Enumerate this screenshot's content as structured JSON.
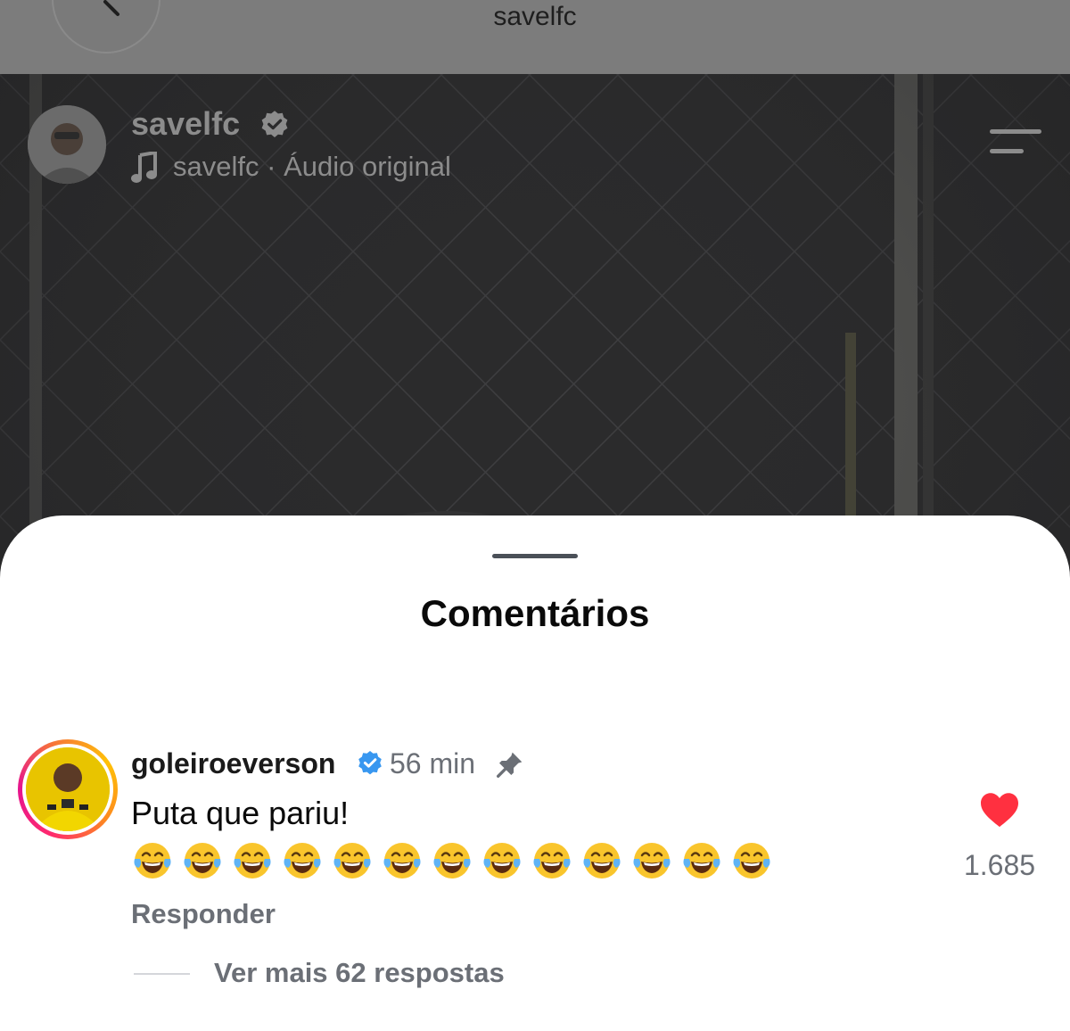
{
  "header": {
    "title": "savelfc",
    "back_icon": "chevron-left-icon"
  },
  "reel": {
    "author": "savelfc",
    "audio_owner": "savelfc",
    "audio_separator": "·",
    "audio_label": "Áudio original",
    "icons": [
      "verified-icon",
      "music-note-icon",
      "menu-icon"
    ]
  },
  "comments_sheet": {
    "title": "Comentários",
    "comment": {
      "username": "goleiroeverson",
      "time": "56 min",
      "text": "Puta que pariu!",
      "emojis": [
        "😂",
        "😂",
        "😂",
        "😂",
        "😂",
        "😂",
        "😂",
        "😂",
        "😂",
        "😂",
        "😂",
        "😂",
        "😂"
      ],
      "reply_label": "Responder",
      "likes": "1.685",
      "view_more_replies": "Ver mais 62 respostas"
    }
  },
  "colors": {
    "verified": "#3897f0",
    "heart": "#ff3040",
    "muted_text": "#6b6f76"
  }
}
